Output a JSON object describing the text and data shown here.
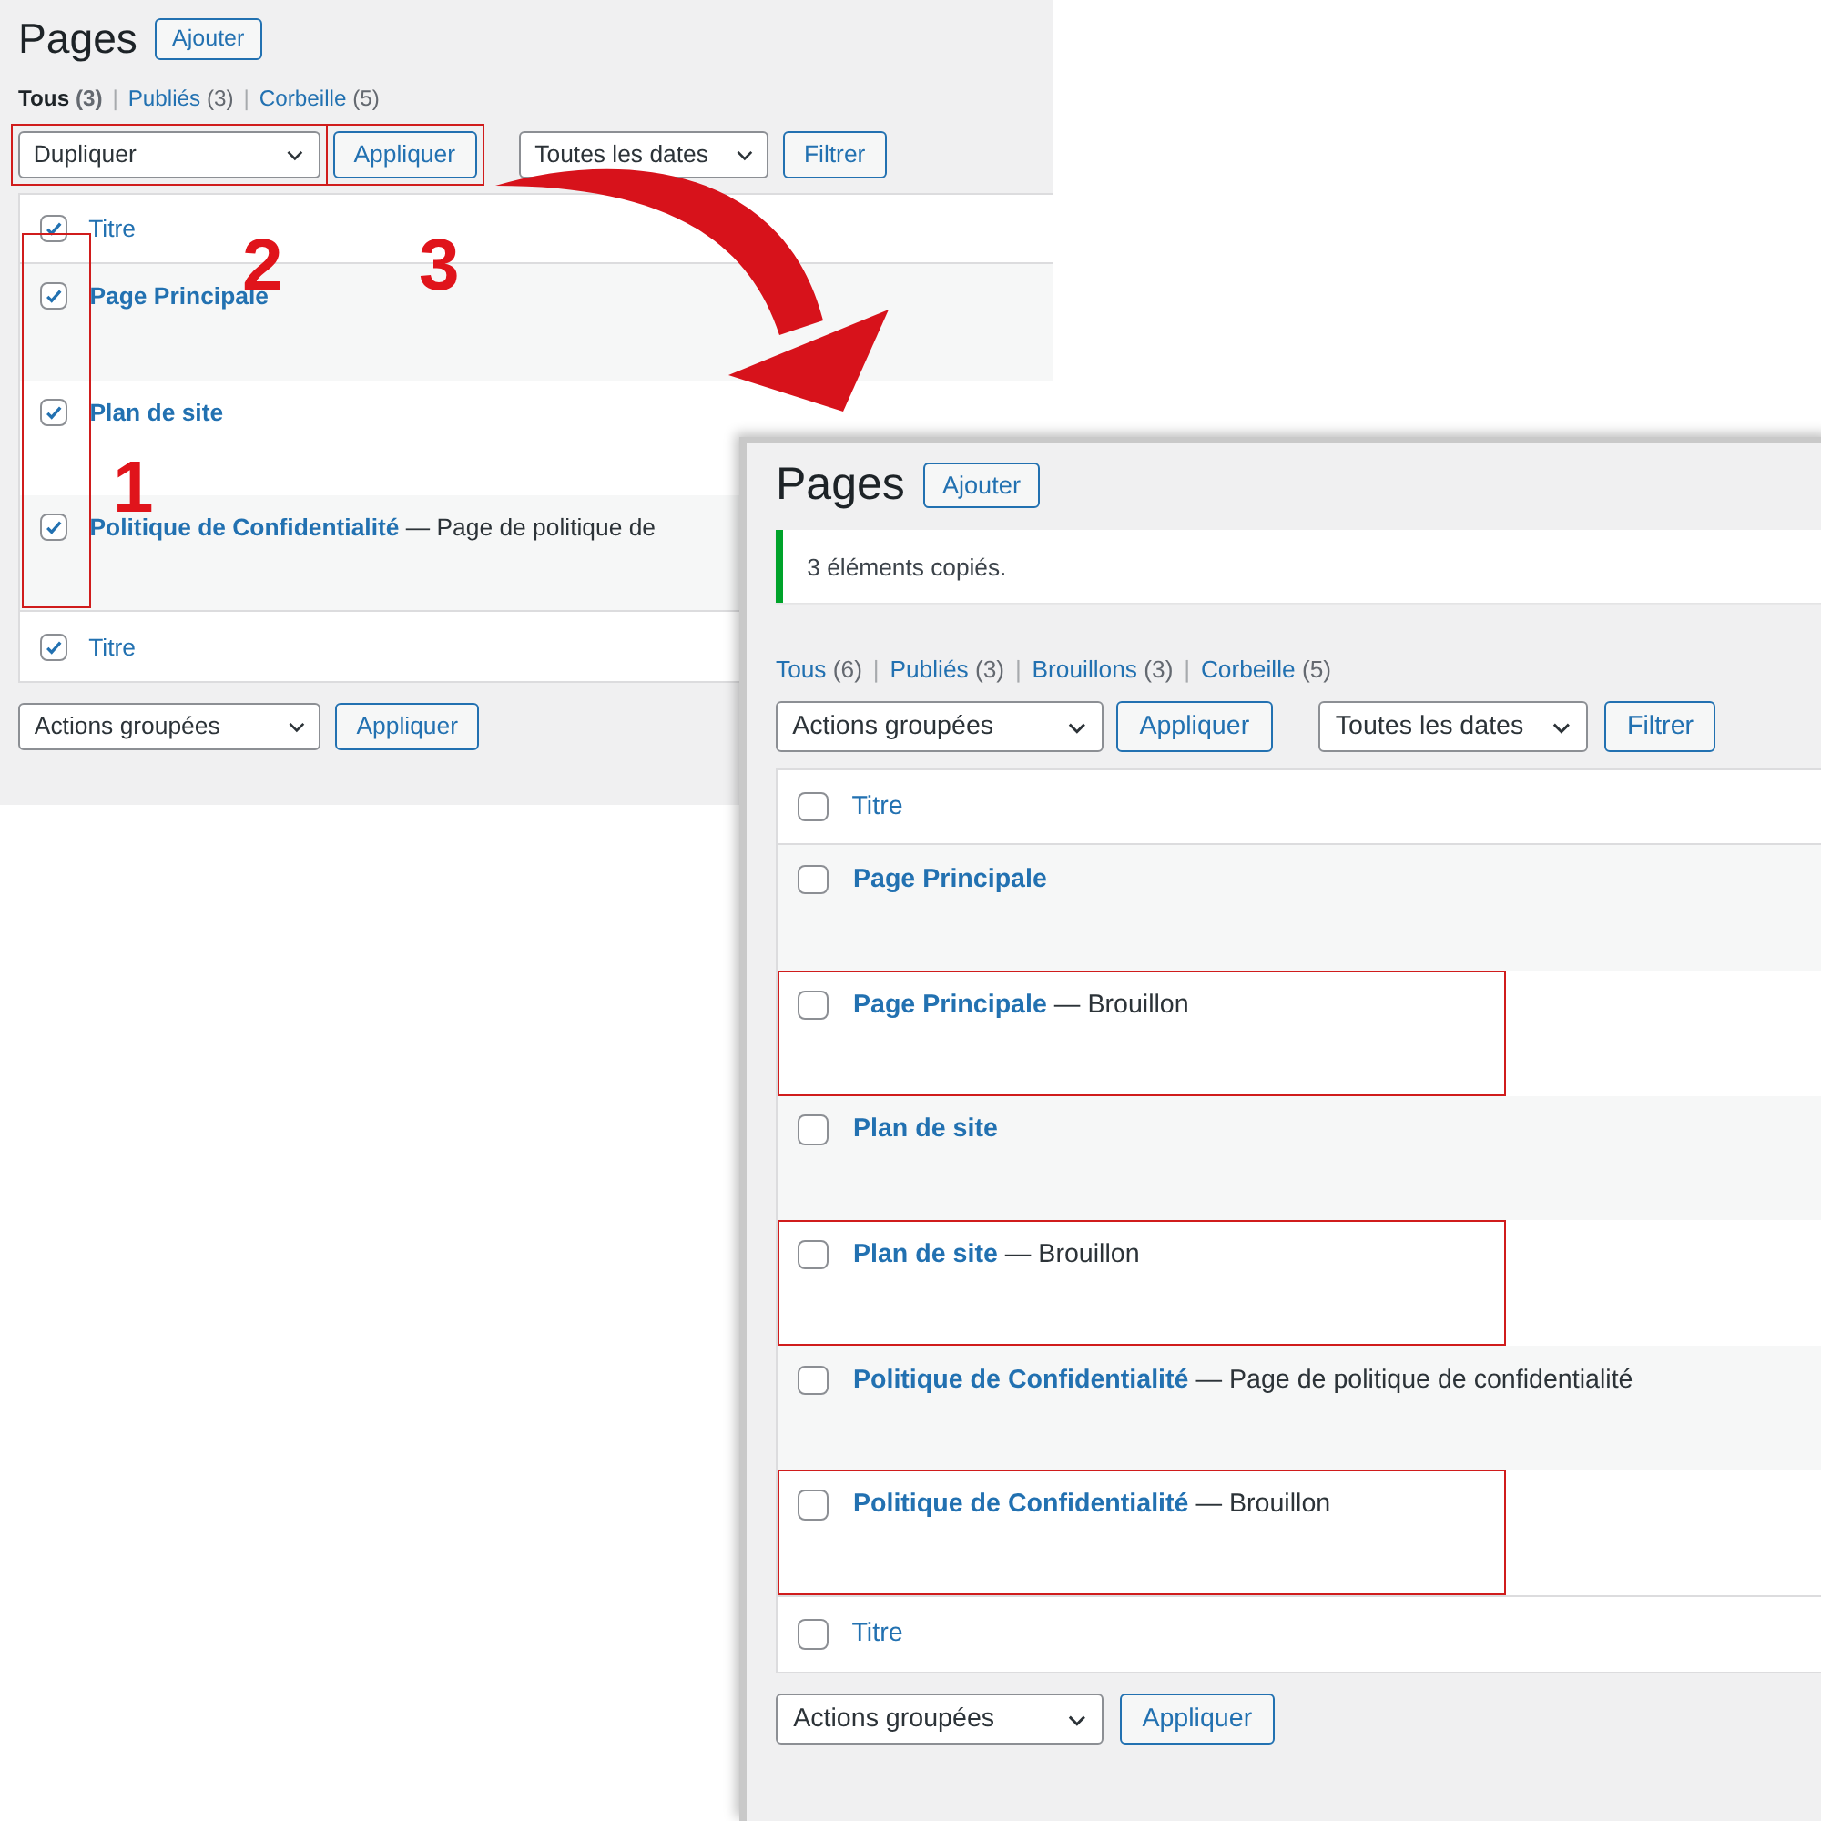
{
  "screens": [
    {
      "title": "Pages",
      "add_button": "Ajouter",
      "views": [
        {
          "label": "Tous",
          "count": "(3)",
          "selected": true
        },
        {
          "separator": "|",
          "label": "Publiés",
          "count": "(3)",
          "selected": false
        },
        {
          "separator": "|",
          "label": "Corbeille",
          "count": "(5)",
          "selected": false
        }
      ],
      "top_actions": {
        "bulk": "Dupliquer",
        "bulk_outlined": true,
        "apply": "Appliquer",
        "apply_outlined": true,
        "dates": "Toutes les dates",
        "filter": "Filtrer"
      },
      "header": {
        "label": "Titre",
        "checked": true
      },
      "rows": [
        {
          "title": "Page Principale",
          "checked": true
        },
        {
          "title": "Plan de site",
          "checked": true
        },
        {
          "title": "Politique de Confidentialité",
          "suffix": "— Page de politique de",
          "checked": true
        }
      ],
      "footer": {
        "label": "Titre",
        "checked": true
      },
      "bottom_actions": {
        "bulk": "Actions groupées",
        "apply": "Appliquer"
      },
      "checkbox_column_outlined": true,
      "callouts": [
        "1",
        "2",
        "3"
      ]
    },
    {
      "title": "Pages",
      "add_button": "Ajouter",
      "notice": "3 éléments copiés.",
      "views": [
        {
          "label": "Tous",
          "count": "(6)",
          "selected": false
        },
        {
          "separator": "|",
          "label": "Publiés",
          "count": "(3)",
          "selected": false
        },
        {
          "separator": "|",
          "label": "Brouillons",
          "count": "(3)",
          "selected": false
        },
        {
          "separator": "|",
          "label": "Corbeille",
          "count": "(5)",
          "selected": false
        }
      ],
      "top_actions": {
        "bulk": "Actions groupées",
        "bulk_outlined": false,
        "apply": "Appliquer",
        "apply_outlined": false,
        "dates": "Toutes les dates",
        "filter": "Filtrer"
      },
      "header": {
        "label": "Titre",
        "checked": false
      },
      "rows": [
        {
          "title": "Page Principale",
          "checked": false,
          "outlined": false
        },
        {
          "title": "Page Principale",
          "suffix": "— Brouillon",
          "checked": false,
          "outlined": true
        },
        {
          "title": "Plan de site",
          "checked": false,
          "outlined": false
        },
        {
          "title": "Plan de site",
          "suffix": "— Brouillon",
          "checked": false,
          "outlined": true
        },
        {
          "title": "Politique de Confidentialité",
          "suffix": "— Page de politique de confidentialité",
          "checked": false,
          "outlined": false
        },
        {
          "title": "Politique de Confidentialité",
          "suffix": "— Brouillon",
          "checked": false,
          "outlined": true
        }
      ],
      "footer": {
        "label": "Titre",
        "checked": false
      },
      "bottom_actions": {
        "bulk": "Actions groupées",
        "apply": "Appliquer"
      }
    }
  ]
}
